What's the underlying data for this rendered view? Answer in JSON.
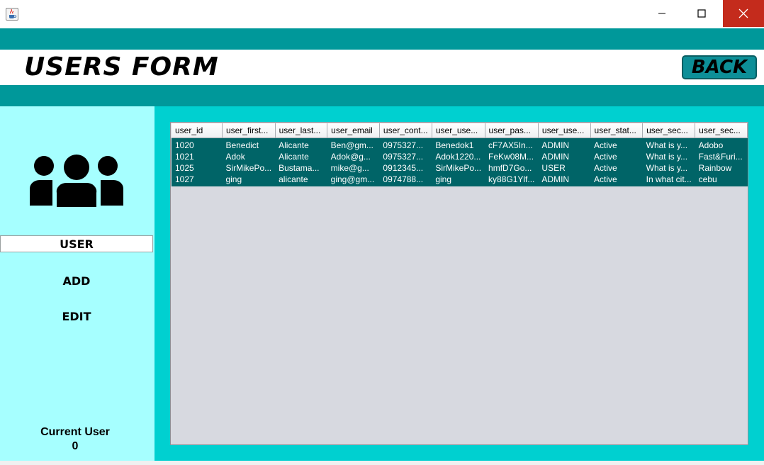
{
  "window": {
    "app_icon": "java-cup-icon",
    "controls": [
      "minimize-icon",
      "maximize-icon",
      "close-icon"
    ]
  },
  "header": {
    "title": "USERS FORM",
    "back_label": "BACK"
  },
  "sidebar": {
    "icon": "users-group-icon",
    "items": [
      {
        "label": "USER",
        "selected": true
      },
      {
        "label": "ADD",
        "selected": false
      },
      {
        "label": "EDIT",
        "selected": false
      }
    ],
    "current_user_label": "Current User",
    "current_user_value": "0"
  },
  "table": {
    "columns": [
      "user_id",
      "user_first...",
      "user_last...",
      "user_email",
      "user_cont...",
      "user_use...",
      "user_pas...",
      "user_use...",
      "user_stat...",
      "user_sec...",
      "user_sec..."
    ],
    "rows": [
      [
        "1020",
        "Benedict",
        "Alicante",
        "Ben@gm...",
        "0975327...",
        "Benedok1",
        "cF7AX5In...",
        "ADMIN",
        "Active",
        "What is y...",
        "Adobo"
      ],
      [
        "1021",
        "Adok",
        "Alicante",
        "Adok@g...",
        "0975327...",
        "Adok1220...",
        "FeKw08M...",
        "ADMIN",
        "Active",
        "What is y...",
        "Fast&Furi..."
      ],
      [
        "1025",
        "SirMikePo...",
        "Bustama...",
        "mike@g...",
        "0912345...",
        "SirMikePo...",
        "hmfD7Go...",
        "USER",
        "Active",
        "What is y...",
        "Rainbow"
      ],
      [
        "1027",
        "ging",
        "alicante",
        "ging@gm...",
        "0974788...",
        "ging",
        "ky88G1Ylf...",
        "ADMIN",
        "Active",
        "In what cit...",
        "cebu"
      ]
    ]
  },
  "colors": {
    "teal_band": "#00989a",
    "main_bg": "#00d0d0",
    "sidebar_bg": "#a6ffff",
    "row_bg": "#006467",
    "back_button": "#0d8f98",
    "close_button": "#c42b1c"
  }
}
